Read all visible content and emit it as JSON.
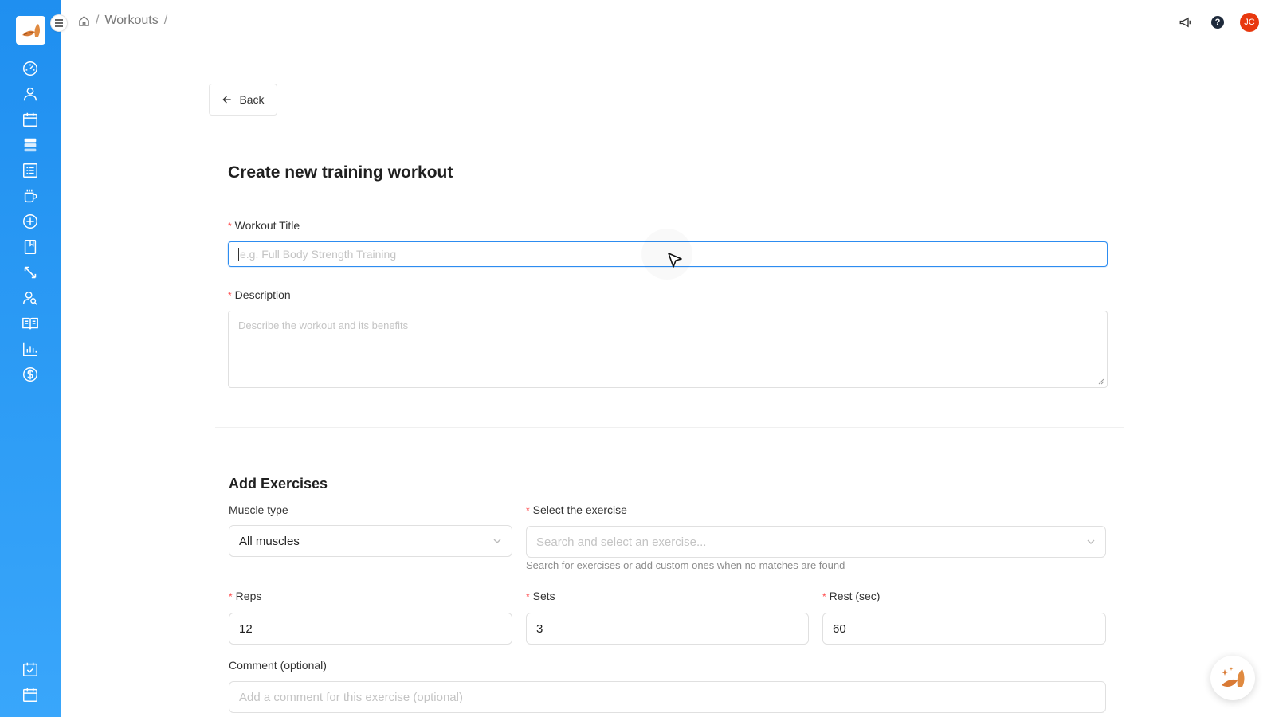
{
  "breadcrumb": {
    "items": [
      "Workouts"
    ],
    "separator": "/"
  },
  "header": {
    "avatar_initials": "JC",
    "help_glyph": "?"
  },
  "page": {
    "back_label": "Back",
    "title": "Create new training workout"
  },
  "form": {
    "workout_title": {
      "label": "Workout Title",
      "placeholder": "e.g. Full Body Strength Training",
      "value": ""
    },
    "description": {
      "label": "Description",
      "placeholder": "Describe the workout and its benefits",
      "value": ""
    }
  },
  "exercises": {
    "section_title": "Add Exercises",
    "muscle_type": {
      "label": "Muscle type",
      "value": "All muscles"
    },
    "select_exercise": {
      "label": "Select the exercise",
      "placeholder": "Search and select an exercise...",
      "help": "Search for exercises or add custom ones when no matches are found"
    },
    "reps": {
      "label": "Reps",
      "value": "12"
    },
    "sets": {
      "label": "Sets",
      "value": "3"
    },
    "rest": {
      "label": "Rest (sec)",
      "value": "60"
    },
    "comment": {
      "label": "Comment (optional)",
      "placeholder": "Add a comment for this exercise (optional)"
    }
  },
  "colors": {
    "sidebar": "#2d9cf5",
    "accent": "#2d8cf0",
    "required": "#ff4d4f",
    "avatar": "#e8380e",
    "brand_logo": "#d97a35"
  },
  "icons": {
    "sidebar": [
      "dashboard-icon",
      "user-icon",
      "calendar-icon",
      "storage-icon",
      "list-icon",
      "drink-icon",
      "add-circle-icon",
      "book-icon",
      "expand-icon",
      "user-search-icon",
      "read-icon",
      "bar-chart-icon",
      "dollar-icon",
      "calendar-check-icon",
      "calendar-icon"
    ],
    "header": [
      "home-icon",
      "megaphone-icon",
      "help-icon"
    ]
  }
}
